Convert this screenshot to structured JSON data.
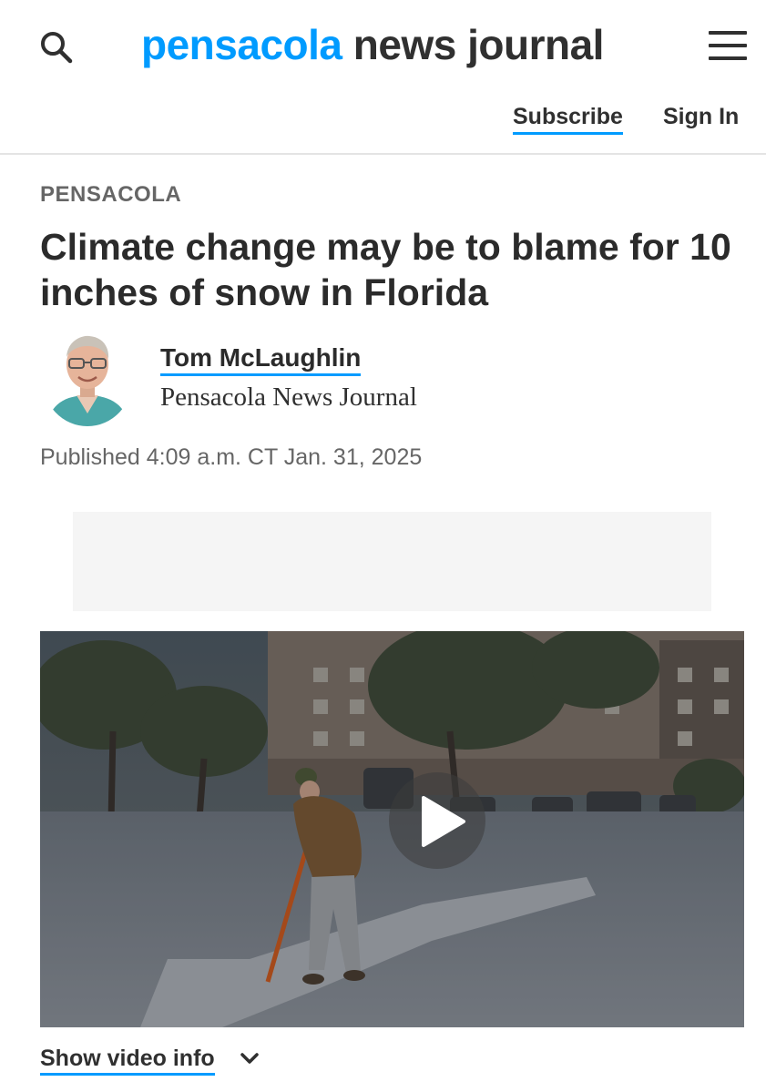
{
  "header": {
    "logo_main": "pensacola",
    "logo_rest": " news journal",
    "subscribe_label": "Subscribe",
    "signin_label": "Sign In",
    "icons": [
      "search-icon",
      "hamburger-menu-icon"
    ]
  },
  "article": {
    "section": "PENSACOLA",
    "headline": "Climate change may be to blame for 10 inches of snow in Florida",
    "author": {
      "name": "Tom McLaughlin",
      "organization": "Pensacola News Journal"
    },
    "published": "Published 4:09 a.m. CT Jan. 31, 2025"
  },
  "video": {
    "show_info_label": "Show video info",
    "icons": [
      "play-icon",
      "chevron-down-icon"
    ]
  },
  "colors": {
    "brand_blue": "#009bff",
    "text_dark": "#2b2b2b",
    "text_gray": "#666666",
    "ad_background": "#f5f5f5"
  }
}
